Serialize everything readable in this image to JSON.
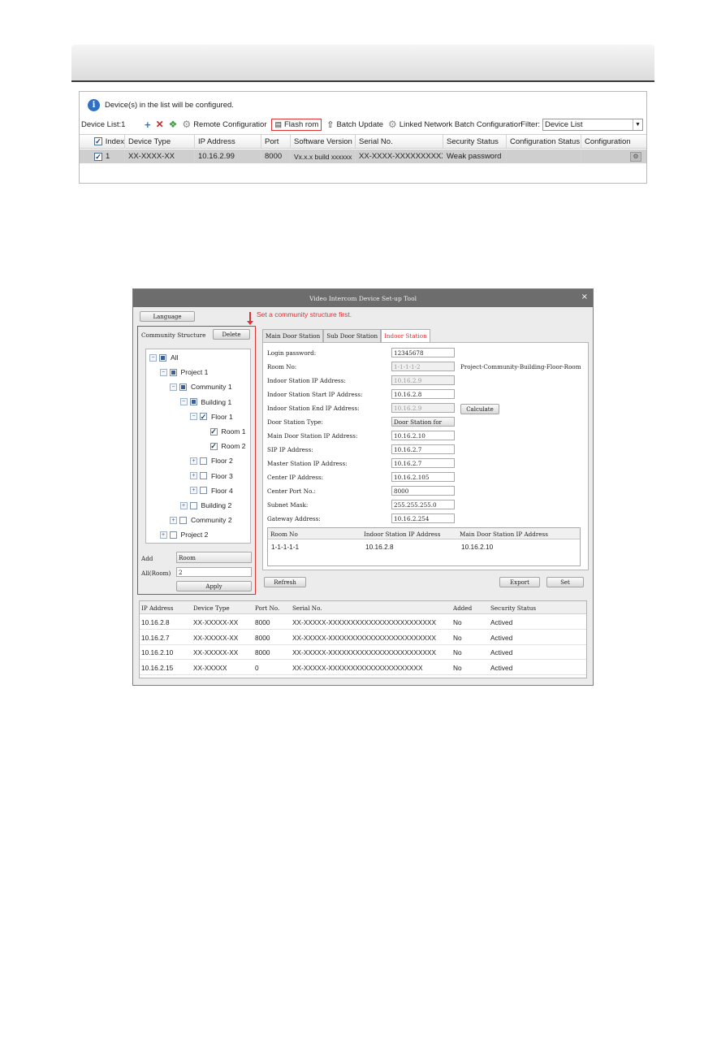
{
  "device_panel": {
    "info_text": "Device(s) in the list will be configured.",
    "list_label": "Device List:1",
    "toolbar": {
      "remote_config": "Remote Configuratior",
      "flash_rom": "Flash rom",
      "batch_update": "Batch Update",
      "linked_network": "Linked Network Batch Configuration"
    },
    "filter_label": "Filter:",
    "filter_value": "Device List",
    "columns": [
      "Index",
      "Device Type",
      "IP Address",
      "Port",
      "Software Version",
      "Serial No.",
      "Security Status",
      "Configuration Status",
      "Configuration"
    ],
    "rows": [
      {
        "index": "1",
        "device_type": "XX-XXXX-XX",
        "ip": "10.16.2.99",
        "port": "8000",
        "software": "Vx.x.x build xxxxxx",
        "serial": "XX-XXXX-XXXXXXXXXX...",
        "security": "Weak password",
        "config_status": ""
      }
    ],
    "icons": [
      "info-icon",
      "add-icon",
      "delete-icon",
      "refresh-icon",
      "gear-icon",
      "flash-icon",
      "upload-icon",
      "network-icon",
      "settings-icon"
    ]
  },
  "setup_tool": {
    "title": "Video Intercom Device Set-up Tool",
    "close": "×",
    "language_button": "Language",
    "hint": "Set a community structure first.",
    "community_structure_label": "Community Structure",
    "delete_button": "Delete",
    "tree": [
      {
        "label": "All",
        "level": 0,
        "expander": "−",
        "state": "part"
      },
      {
        "label": "Project 1",
        "level": 1,
        "expander": "−",
        "state": "part"
      },
      {
        "label": "Community 1",
        "level": 2,
        "expander": "−",
        "state": "part"
      },
      {
        "label": "Building 1",
        "level": 3,
        "expander": "−",
        "state": "part"
      },
      {
        "label": "Floor 1",
        "level": 4,
        "expander": "−",
        "state": "full"
      },
      {
        "label": "Room 1",
        "level": 5,
        "expander": "",
        "state": "full"
      },
      {
        "label": "Room 2",
        "level": 5,
        "expander": "",
        "state": "full"
      },
      {
        "label": "Floor 2",
        "level": 4,
        "expander": "+",
        "state": "empty"
      },
      {
        "label": "Floor 3",
        "level": 4,
        "expander": "+",
        "state": "empty"
      },
      {
        "label": "Floor 4",
        "level": 4,
        "expander": "+",
        "state": "empty"
      },
      {
        "label": "Building 2",
        "level": 3,
        "expander": "+",
        "state": "empty"
      },
      {
        "label": "Community 2",
        "level": 2,
        "expander": "+",
        "state": "empty"
      },
      {
        "label": "Project 2",
        "level": 1,
        "expander": "+",
        "state": "empty"
      }
    ],
    "add_label": "Add",
    "add_value": "Room",
    "all_room_label": "All(Room)",
    "all_room_value": "2",
    "apply_button": "Apply",
    "tabs": [
      "Main Door Station",
      "Sub Door Station",
      "Indoor Station"
    ],
    "active_tab": "Indoor Station",
    "form": {
      "login_password": {
        "label": "Login password:",
        "value": "12345678"
      },
      "room_no": {
        "label": "Room No:",
        "value": "1-1-1-1-2",
        "hint": "Project-Community-Building-Floor-Room"
      },
      "indoor_ip": {
        "label": "Indoor Station IP Address:",
        "value": "10.16.2.9"
      },
      "indoor_start_ip": {
        "label": "Indoor Station Start IP Address:",
        "value": "10.16.2.8"
      },
      "indoor_end_ip": {
        "label": "Indoor Station End IP Address:",
        "value": "10.16.2.9"
      },
      "calculate_button": "Calculate",
      "door_station_type": {
        "label": "Door Station Type:",
        "value": "Door Station for"
      },
      "main_door_ip": {
        "label": "Main Door Station IP Address:",
        "value": "10.16.2.10"
      },
      "sip_ip": {
        "label": "SIP IP Address:",
        "value": "10.16.2.7"
      },
      "master_ip": {
        "label": "Master Station IP Address:",
        "value": "10.16.2.7"
      },
      "center_ip": {
        "label": "Center IP Address:",
        "value": "10.16.2.105"
      },
      "center_port": {
        "label": "Center Port No.:",
        "value": "8000"
      },
      "subnet_mask": {
        "label": "Subnet Mask:",
        "value": "255.255.255.0"
      },
      "gateway": {
        "label": "Gateway Address:",
        "value": "10.16.2.254"
      }
    },
    "room_table": {
      "columns": [
        "Room No",
        "Indoor Station IP Address",
        "Main Door Station IP Address"
      ],
      "rows": [
        [
          "1-1-1-1-1",
          "10.16.2.8",
          "10.16.2.10"
        ]
      ]
    },
    "refresh_button": "Refresh",
    "export_button": "Export",
    "set_button": "Set",
    "device_grid": {
      "columns": [
        "IP Address",
        "Device Type",
        "Port No.",
        "Serial No.",
        "Added",
        "Security Status"
      ],
      "rows": [
        [
          "10.16.2.8",
          "XX-XXXXX-XX",
          "8000",
          "XX-XXXXX-XXXXXXXXXXXXXXXXXXXXXXXX",
          "No",
          "Actived"
        ],
        [
          "10.16.2.7",
          "XX-XXXXX-XX",
          "8000",
          "XX-XXXXX-XXXXXXXXXXXXXXXXXXXXXXXX",
          "No",
          "Actived"
        ],
        [
          "10.16.2.10",
          "XX-XXXXX-XX",
          "8000",
          "XX-XXXXX-XXXXXXXXXXXXXXXXXXXXXXXX",
          "No",
          "Actived"
        ],
        [
          "10.16.2.15",
          "XX-XXXXX",
          "0",
          "XX-XXXXX-XXXXXXXXXXXXXXXXXXXXX",
          "No",
          "Actived"
        ]
      ]
    }
  }
}
